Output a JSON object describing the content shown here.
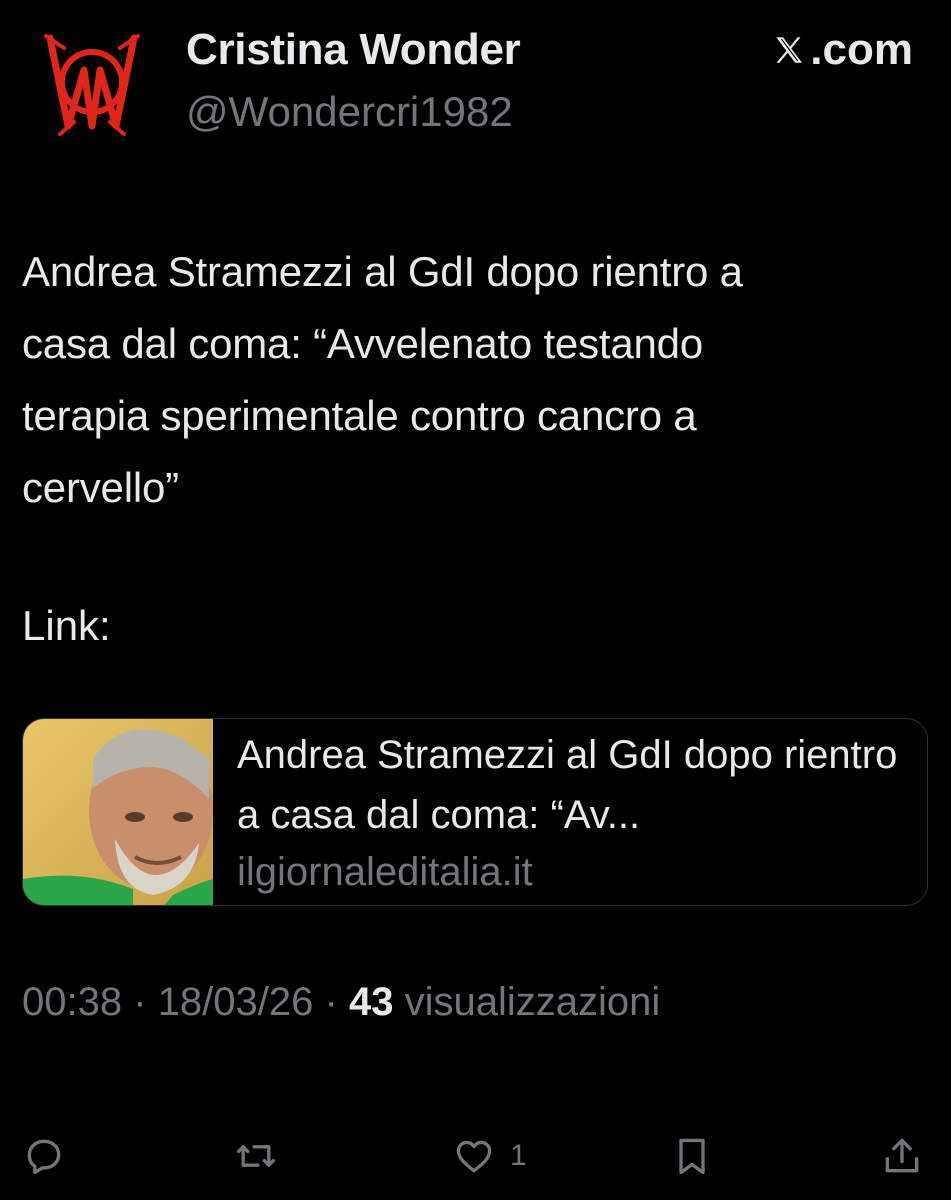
{
  "post": {
    "display_name": "Cristina Wonder",
    "handle": "@Wondercri1982",
    "site": ".com",
    "text": "Andrea Stramezzi al GdI dopo rientro a\ncasa dal coma: “Avvelenato testando\nterapia sperimentale contro cancro a\ncervello”",
    "link_label": "Link:",
    "card": {
      "title": "Andrea Stramezzi al GdI dopo rientro a casa dal coma: “Av...",
      "domain": "ilgiornaleditalia.it"
    },
    "meta": {
      "time": "00:38",
      "separator": "·",
      "date": "18/03/26",
      "views_count": "43",
      "views_label": "visualizzazioni"
    }
  },
  "actions": {
    "reply_icon": "reply-icon",
    "repost_icon": "repost-icon",
    "like_icon": "heart-icon",
    "like_count": "1",
    "bookmark_icon": "bookmark-icon",
    "share_icon": "share-icon"
  },
  "colors": {
    "background": "#000000",
    "primary_text": "#e7e9ea",
    "secondary_text": "#71767b",
    "avatar_red": "#e0261b",
    "card_border": "#2f3336"
  }
}
